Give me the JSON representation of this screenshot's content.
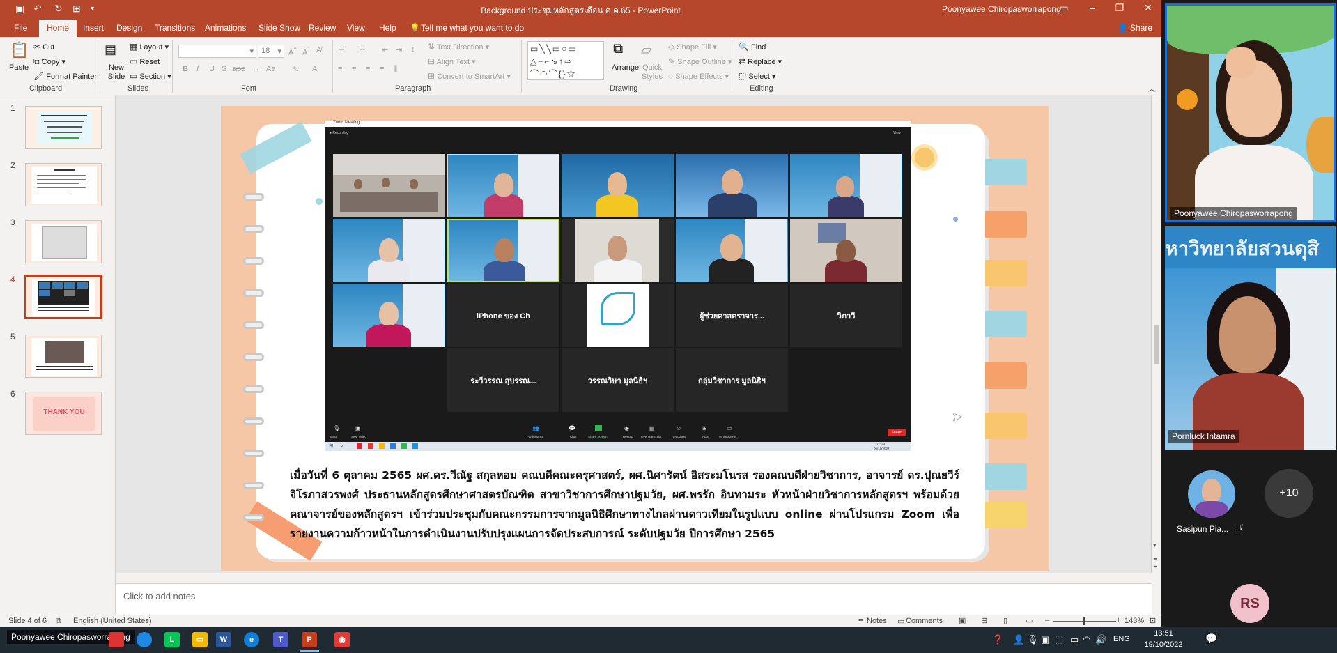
{
  "window": {
    "doc_title": "Background ประชุมหลักสูตรเดือน ต.ค.65  -  PowerPoint",
    "user": "Poonyawee Chiropasworrapong"
  },
  "menu": {
    "tabs": [
      "File",
      "Home",
      "Insert",
      "Design",
      "Transitions",
      "Animations",
      "Slide Show",
      "Review",
      "View",
      "Help"
    ],
    "tell_me": "Tell me what you want to do",
    "share": "Share"
  },
  "ribbon": {
    "clipboard": {
      "paste": "Paste",
      "cut": "Cut",
      "copy": "Copy",
      "format_painter": "Format Painter",
      "group": "Clipboard"
    },
    "slides": {
      "new_slide": "New Slide",
      "layout": "Layout",
      "reset": "Reset",
      "section": "Section",
      "group": "Slides"
    },
    "font": {
      "size": "18",
      "group": "Font"
    },
    "paragraph": {
      "text_direction": "Text Direction",
      "align_text": "Align Text",
      "convert_smartart": "Convert to SmartArt",
      "group": "Paragraph"
    },
    "drawing": {
      "arrange": "Arrange",
      "quick_styles": "Quick Styles",
      "shape_fill": "Shape Fill",
      "shape_outline": "Shape Outline",
      "shape_effects": "Shape Effects",
      "group": "Drawing"
    },
    "editing": {
      "find": "Find",
      "replace": "Replace",
      "select": "Select",
      "group": "Editing"
    }
  },
  "thumbnails": [
    {
      "num": "1",
      "thank_you": ""
    },
    {
      "num": "2",
      "thank_you": ""
    },
    {
      "num": "3",
      "thank_you": ""
    },
    {
      "num": "4",
      "thank_you": ""
    },
    {
      "num": "5",
      "thank_you": ""
    },
    {
      "num": "6",
      "thank_you": "THANK YOU"
    }
  ],
  "zoom_window": {
    "title": "Zoom Meeting",
    "recording": "Recording",
    "view": "View",
    "tiles_text": {
      "t12": "iPhone ของ Ch",
      "t14": "ผู้ช่วยศาสตราจาร...",
      "t15": "วิภาวี",
      "t17": "ระวีวรรณ สุบรรณ...",
      "t18": "วรรณวิษา มูลนิธิฯ",
      "t19": "กลุ่มวิชาการ มูลนิธิฯ"
    },
    "toolbar": [
      "Mute",
      "Stop Video",
      "Participants",
      "Chat",
      "Share Screen",
      "Record",
      "Live Transcript",
      "Reactions",
      "Apps",
      "Whiteboards"
    ],
    "leave": "Leave",
    "time": "11:19",
    "date": "06/10/2022"
  },
  "slide_caption": "เมื่อวันที่ 6 ตุลาคม 2565 ผศ.ดร.วีณัฐ สกุลหอม คณบดีคณะครุศาสตร์, ผศ.นิศารัตน์ อิสระมโนรส รองคณบดีฝ่ายวิชาการ, อาจารย์ ดร.ปุณยวีร์ จิโรภาสวรพงศ์ ประธานหลักสูตรศึกษาศาสตรบัณฑิต สาขาวิชาการศึกษาปฐมวัย, ผศ.พรรัก อินทามระ หัวหน้าฝ่ายวิชาการหลักสูตรฯ พร้อมด้วยคณาจารย์ของหลักสูตรฯ เข้าร่วมประชุมกับคณะกรรมการจากมูลนิธิศึกษาทางไกลผ่านดาวเทียมในรูปแบบ online ผ่านโปรแกรม Zoom เพื่อรายงานความก้าวหน้าในการดำเนินงานปรับปรุงแผนการจัดประสบการณ์ ระดับปฐมวัย ปีการศึกษา 2565",
  "notes_placeholder": "Click to add notes",
  "status": {
    "slide_of": "Slide 4 of 6",
    "language": "English (United States)",
    "notes": "Notes",
    "comments": "Comments",
    "zoom": "143%"
  },
  "gallery": {
    "p1": "Poonyawee Chiropasworrapong",
    "p2": "Pornluck Intamra",
    "banner": "หาวิทยาลัยสวนดุสิ",
    "p3": "Sasipun Pia...",
    "more": "+10",
    "rs": "RS"
  },
  "taskbar": {
    "active_speaker": "Poonyawee Chiropasworrapong",
    "lang": "ENG",
    "time": "13:51",
    "date": "19/10/2022"
  },
  "colors": {
    "ppt_accent": "#b7472a",
    "slide_bg": "#f6c7a6",
    "zoom_leave": "#e02828"
  }
}
